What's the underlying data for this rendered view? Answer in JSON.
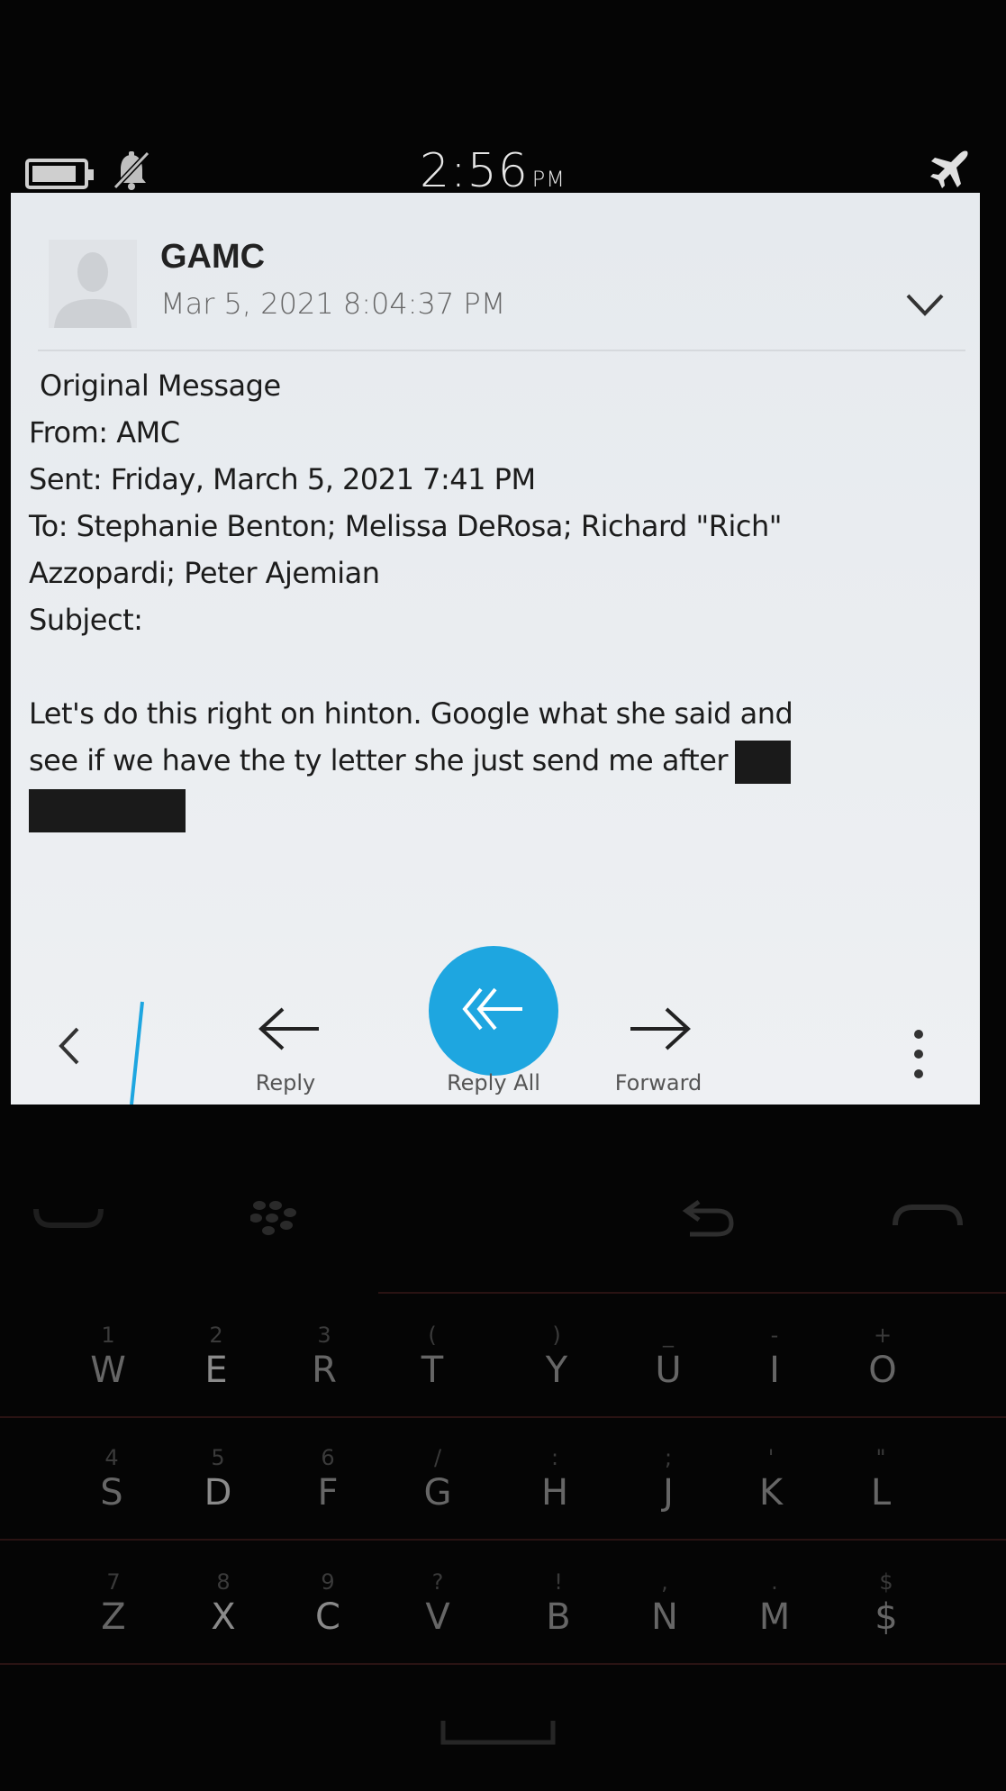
{
  "status_bar": {
    "time": "2:56",
    "ampm": "PM",
    "battery_level": 0.9,
    "icons": [
      "battery-icon",
      "notifications-muted-icon",
      "airplane-mode-icon"
    ]
  },
  "message": {
    "sender": "GAMC",
    "datetime": "Mar 5, 2021 8:04:37 PM",
    "body_lines": [
      "Original Message",
      "From: AMC",
      "Sent: Friday, March 5, 2021 7:41 PM",
      "To: Stephanie Benton; Melissa DeRosa; Richard \"Rich\"",
      "Azzopardi; Peter Ajemian",
      "Subject:",
      "Let's do this right on hinton. Google what she said and",
      "see if we have the ty letter she just send me after"
    ]
  },
  "actions": {
    "reply": "Reply",
    "reply_all": "Reply All",
    "forward": "Forward"
  },
  "colors": {
    "accent": "#1ea6e0",
    "screen_bg": "#e9ecef",
    "device_bg": "#050505"
  },
  "keyboard": {
    "row1": [
      {
        "alt": "1",
        "key": "W"
      },
      {
        "alt": "2",
        "key": "E"
      },
      {
        "alt": "3",
        "key": "R"
      },
      {
        "alt": "(",
        "key": "T"
      },
      {
        "alt": ")",
        "key": "Y"
      },
      {
        "alt": "_",
        "key": "U"
      },
      {
        "alt": "-",
        "key": "I"
      },
      {
        "alt": "+",
        "key": "O"
      }
    ],
    "row2": [
      {
        "alt": "4",
        "key": "S"
      },
      {
        "alt": "5",
        "key": "D"
      },
      {
        "alt": "6",
        "key": "F"
      },
      {
        "alt": "/",
        "key": "G"
      },
      {
        "alt": ":",
        "key": "H"
      },
      {
        "alt": ";",
        "key": "J"
      },
      {
        "alt": "'",
        "key": "K"
      },
      {
        "alt": "\"",
        "key": "L"
      }
    ],
    "row3": [
      {
        "alt": "7",
        "key": "Z"
      },
      {
        "alt": "8",
        "key": "X"
      },
      {
        "alt": "9",
        "key": "C"
      },
      {
        "alt": "?",
        "key": "V"
      },
      {
        "alt": "!",
        "key": "B"
      },
      {
        "alt": ",",
        "key": "N"
      },
      {
        "alt": ".",
        "key": "M"
      },
      {
        "alt": "$",
        "key": "$"
      }
    ]
  }
}
